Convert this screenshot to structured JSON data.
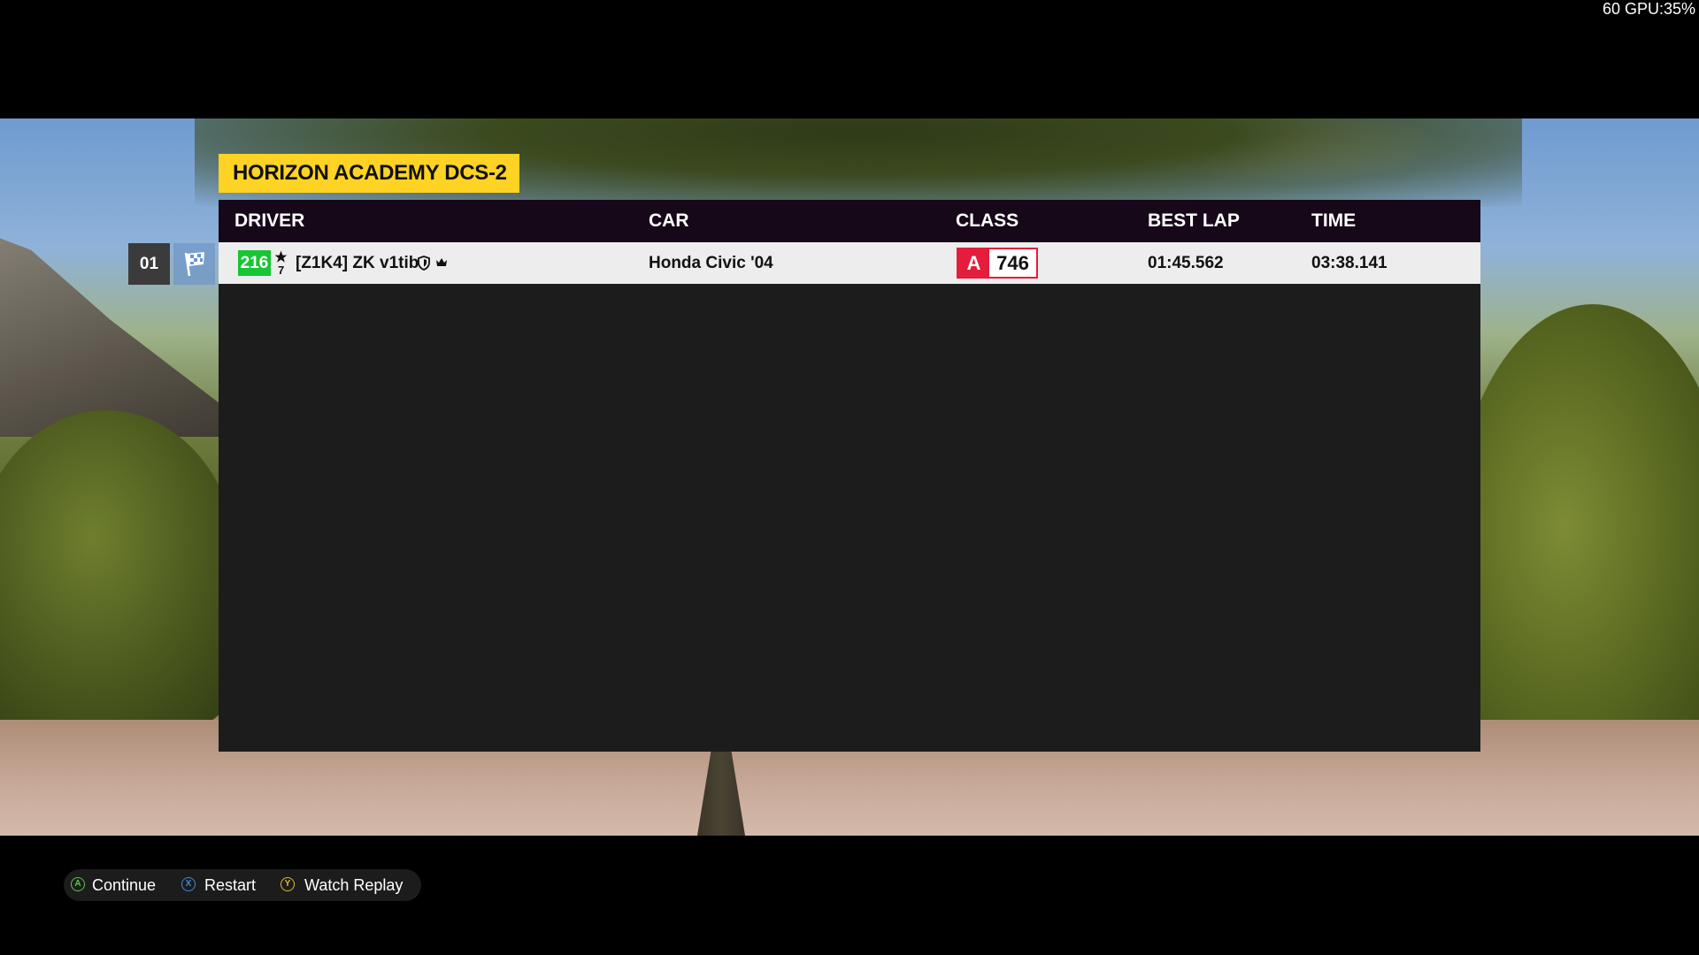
{
  "overlay": {
    "perf_text": "60 GPU:35%"
  },
  "event": {
    "title": "HORIZON ACADEMY DCS-2"
  },
  "table": {
    "headers": {
      "driver": "DRIVER",
      "car": "CAR",
      "class": "CLASS",
      "best_lap": "BEST LAP",
      "time": "TIME"
    },
    "rows": [
      {
        "position": "01",
        "level": "216",
        "rank_number": "7",
        "driver": "[Z1K4] ZK v1tib",
        "car": "Honda Civic '04",
        "class_letter": "A",
        "class_pi": "746",
        "best_lap": "01:45.562",
        "time": "03:38.141"
      }
    ]
  },
  "prompts": {
    "continue_label": "Continue",
    "restart_label": "Restart",
    "replay_label": "Watch Replay",
    "glyph_a": "A",
    "glyph_x": "X",
    "glyph_y": "Y"
  },
  "colors": {
    "title_bar": "#ffd323",
    "level_badge": "#16c633",
    "class_a": "#e31d3b",
    "header_bg": "#160818"
  }
}
